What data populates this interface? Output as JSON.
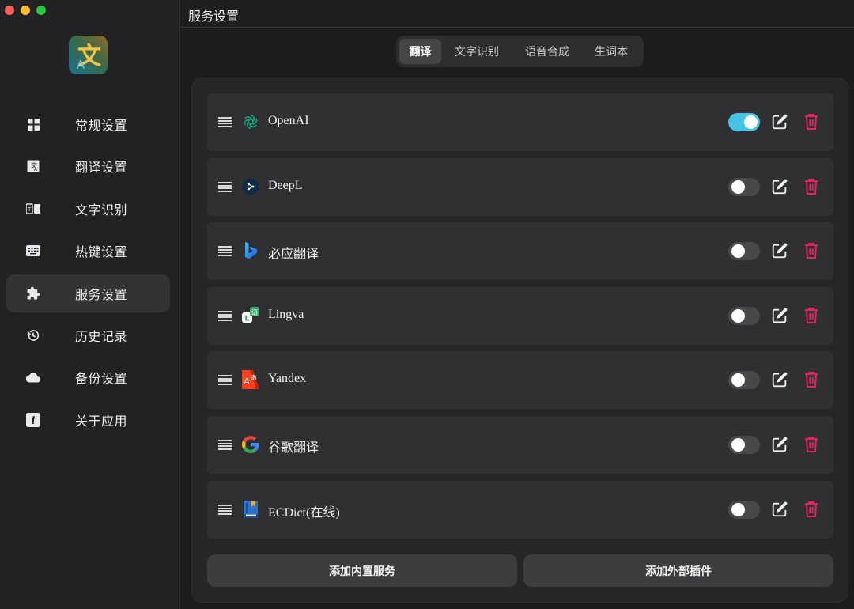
{
  "window": {
    "traffic_lights": [
      "close",
      "minimize",
      "maximize"
    ]
  },
  "header": {
    "title": "服务设置"
  },
  "sidebar": {
    "items": [
      {
        "label": "常规设置",
        "icon": "grid-icon",
        "active": false
      },
      {
        "label": "翻译设置",
        "icon": "translate-icon",
        "active": false
      },
      {
        "label": "文字识别",
        "icon": "ocr-icon",
        "active": false
      },
      {
        "label": "热键设置",
        "icon": "keyboard-icon",
        "active": false
      },
      {
        "label": "服务设置",
        "icon": "puzzle-icon",
        "active": true
      },
      {
        "label": "历史记录",
        "icon": "history-icon",
        "active": false
      },
      {
        "label": "备份设置",
        "icon": "cloud-icon",
        "active": false
      },
      {
        "label": "关于应用",
        "icon": "info-icon",
        "active": false
      }
    ]
  },
  "tabs": [
    {
      "label": "翻译",
      "active": true
    },
    {
      "label": "文字识别",
      "active": false
    },
    {
      "label": "语音合成",
      "active": false
    },
    {
      "label": "生词本",
      "active": false
    }
  ],
  "services": [
    {
      "name": "OpenAI",
      "icon": "openai-icon",
      "enabled": true
    },
    {
      "name": "DeepL",
      "icon": "deepl-icon",
      "enabled": false
    },
    {
      "name": "必应翻译",
      "icon": "bing-icon",
      "enabled": false
    },
    {
      "name": "Lingva",
      "icon": "lingva-icon",
      "enabled": false
    },
    {
      "name": "Yandex",
      "icon": "yandex-icon",
      "enabled": false
    },
    {
      "name": "谷歌翻译",
      "icon": "google-icon",
      "enabled": false
    },
    {
      "name": "ECDict(在线)",
      "icon": "ecdict-icon",
      "enabled": false
    }
  ],
  "actions": {
    "add_builtin": "添加内置服务",
    "add_external": "添加外部插件"
  },
  "colors": {
    "toggle_on": "#45c4e5",
    "delete": "#e0245e",
    "background": "#1c1c1e"
  }
}
